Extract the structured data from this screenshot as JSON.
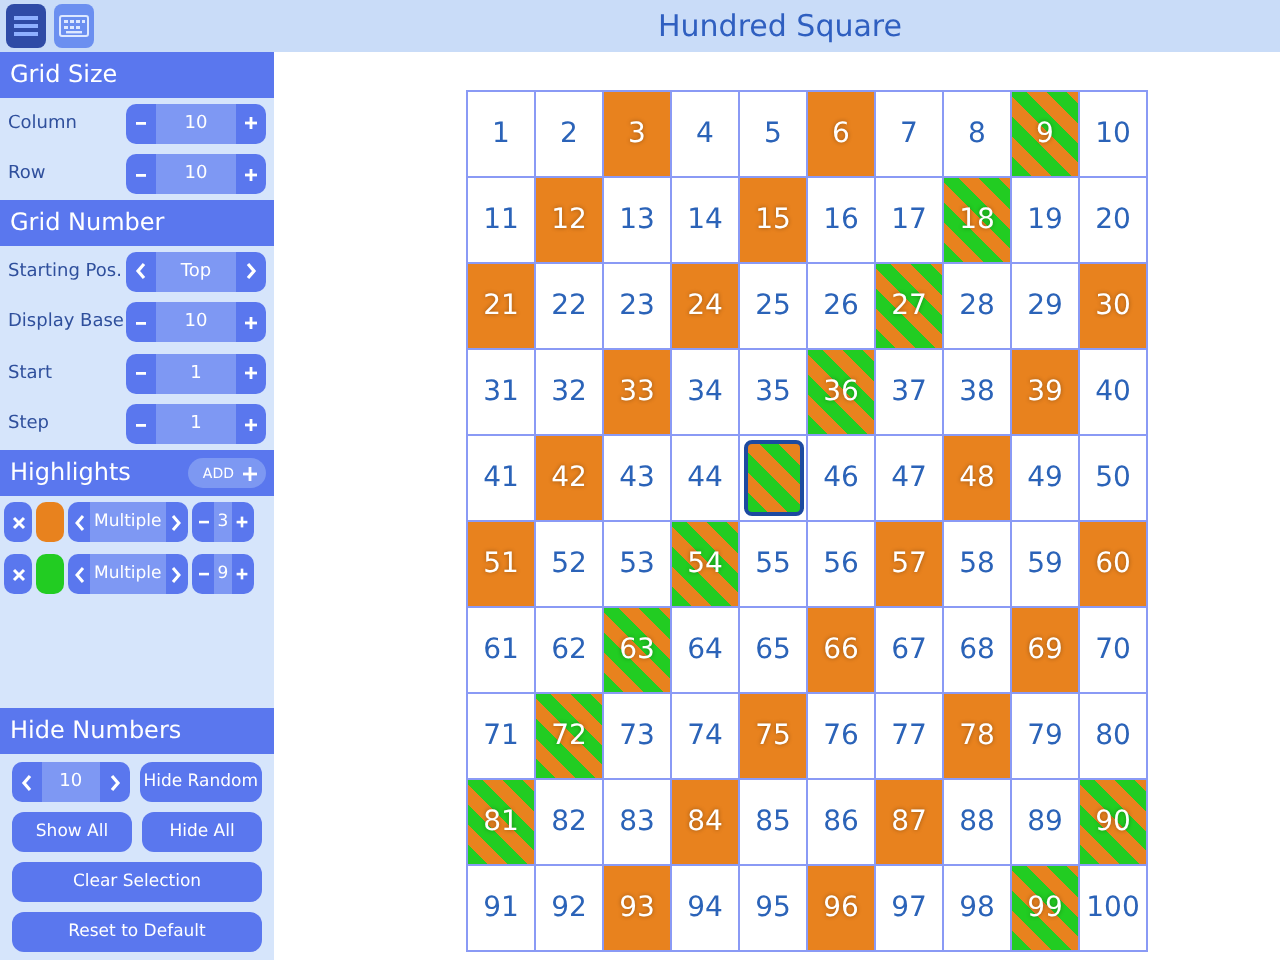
{
  "title": "Hundred Square",
  "grid_size": {
    "title": "Grid Size",
    "rows": [
      {
        "label": "Column",
        "kind": "stepper",
        "value": "10"
      },
      {
        "label": "Row",
        "kind": "stepper",
        "value": "10"
      }
    ]
  },
  "grid_number": {
    "title": "Grid Number",
    "rows": [
      {
        "label": "Starting Pos.",
        "kind": "selector",
        "value": "Top"
      },
      {
        "label": "Display Base",
        "kind": "stepper",
        "value": "10"
      },
      {
        "label": "Start",
        "kind": "stepper",
        "value": "1"
      },
      {
        "label": "Step",
        "kind": "stepper",
        "value": "1"
      }
    ]
  },
  "highlights": {
    "title": "Highlights",
    "add_label": "ADD",
    "items": [
      {
        "color": "#e8821e",
        "rule": "Multiple",
        "value": "3"
      },
      {
        "color": "#22cc22",
        "rule": "Multiple",
        "value": "9"
      }
    ]
  },
  "hide_numbers": {
    "title": "Hide Numbers",
    "count": "10",
    "hide_random": "Hide Random",
    "show_all": "Show All",
    "hide_all": "Hide All",
    "clear": "Clear Selection",
    "reset": "Reset to Default"
  },
  "cells": [
    {
      "text": "1",
      "kind": "plain",
      "hidden": false
    },
    {
      "text": "2",
      "kind": "plain",
      "hidden": false
    },
    {
      "text": "3",
      "kind": "single",
      "hidden": false
    },
    {
      "text": "4",
      "kind": "plain",
      "hidden": false
    },
    {
      "text": "5",
      "kind": "plain",
      "hidden": false
    },
    {
      "text": "6",
      "kind": "single",
      "hidden": false
    },
    {
      "text": "7",
      "kind": "plain",
      "hidden": false
    },
    {
      "text": "8",
      "kind": "plain",
      "hidden": false
    },
    {
      "text": "9",
      "kind": "double",
      "hidden": false
    },
    {
      "text": "10",
      "kind": "plain",
      "hidden": false
    },
    {
      "text": "11",
      "kind": "plain",
      "hidden": false
    },
    {
      "text": "12",
      "kind": "single",
      "hidden": false
    },
    {
      "text": "13",
      "kind": "plain",
      "hidden": false
    },
    {
      "text": "14",
      "kind": "plain",
      "hidden": false
    },
    {
      "text": "15",
      "kind": "single",
      "hidden": false
    },
    {
      "text": "16",
      "kind": "plain",
      "hidden": false
    },
    {
      "text": "17",
      "kind": "plain",
      "hidden": false
    },
    {
      "text": "18",
      "kind": "double",
      "hidden": false
    },
    {
      "text": "19",
      "kind": "plain",
      "hidden": false
    },
    {
      "text": "20",
      "kind": "plain",
      "hidden": false
    },
    {
      "text": "21",
      "kind": "single",
      "hidden": false
    },
    {
      "text": "22",
      "kind": "plain",
      "hidden": false
    },
    {
      "text": "23",
      "kind": "plain",
      "hidden": false
    },
    {
      "text": "24",
      "kind": "single",
      "hidden": false
    },
    {
      "text": "25",
      "kind": "plain",
      "hidden": false
    },
    {
      "text": "26",
      "kind": "plain",
      "hidden": false
    },
    {
      "text": "27",
      "kind": "double",
      "hidden": false
    },
    {
      "text": "28",
      "kind": "plain",
      "hidden": false
    },
    {
      "text": "29",
      "kind": "plain",
      "hidden": false
    },
    {
      "text": "30",
      "kind": "single",
      "hidden": false
    },
    {
      "text": "31",
      "kind": "plain",
      "hidden": false
    },
    {
      "text": "32",
      "kind": "plain",
      "hidden": false
    },
    {
      "text": "33",
      "kind": "single",
      "hidden": false
    },
    {
      "text": "34",
      "kind": "plain",
      "hidden": false
    },
    {
      "text": "35",
      "kind": "plain",
      "hidden": false
    },
    {
      "text": "36",
      "kind": "double",
      "hidden": false
    },
    {
      "text": "37",
      "kind": "plain",
      "hidden": false
    },
    {
      "text": "38",
      "kind": "plain",
      "hidden": false
    },
    {
      "text": "39",
      "kind": "single",
      "hidden": false
    },
    {
      "text": "40",
      "kind": "plain",
      "hidden": false
    },
    {
      "text": "41",
      "kind": "plain",
      "hidden": false
    },
    {
      "text": "42",
      "kind": "single",
      "hidden": false
    },
    {
      "text": "43",
      "kind": "plain",
      "hidden": false
    },
    {
      "text": "44",
      "kind": "plain",
      "hidden": false
    },
    {
      "kind": "double",
      "hidden": true
    },
    {
      "text": "46",
      "kind": "plain",
      "hidden": false
    },
    {
      "text": "47",
      "kind": "plain",
      "hidden": false
    },
    {
      "text": "48",
      "kind": "single",
      "hidden": false
    },
    {
      "text": "49",
      "kind": "plain",
      "hidden": false
    },
    {
      "text": "50",
      "kind": "plain",
      "hidden": false
    },
    {
      "text": "51",
      "kind": "single",
      "hidden": false
    },
    {
      "text": "52",
      "kind": "plain",
      "hidden": false
    },
    {
      "text": "53",
      "kind": "plain",
      "hidden": false
    },
    {
      "text": "54",
      "kind": "double",
      "hidden": false
    },
    {
      "text": "55",
      "kind": "plain",
      "hidden": false
    },
    {
      "text": "56",
      "kind": "plain",
      "hidden": false
    },
    {
      "text": "57",
      "kind": "single",
      "hidden": false
    },
    {
      "text": "58",
      "kind": "plain",
      "hidden": false
    },
    {
      "text": "59",
      "kind": "plain",
      "hidden": false
    },
    {
      "text": "60",
      "kind": "single",
      "hidden": false
    },
    {
      "text": "61",
      "kind": "plain",
      "hidden": false
    },
    {
      "text": "62",
      "kind": "plain",
      "hidden": false
    },
    {
      "text": "63",
      "kind": "double",
      "hidden": false
    },
    {
      "text": "64",
      "kind": "plain",
      "hidden": false
    },
    {
      "text": "65",
      "kind": "plain",
      "hidden": false
    },
    {
      "text": "66",
      "kind": "single",
      "hidden": false
    },
    {
      "text": "67",
      "kind": "plain",
      "hidden": false
    },
    {
      "text": "68",
      "kind": "plain",
      "hidden": false
    },
    {
      "text": "69",
      "kind": "single",
      "hidden": false
    },
    {
      "text": "70",
      "kind": "plain",
      "hidden": false
    },
    {
      "text": "71",
      "kind": "plain",
      "hidden": false
    },
    {
      "text": "72",
      "kind": "double",
      "hidden": false
    },
    {
      "text": "73",
      "kind": "plain",
      "hidden": false
    },
    {
      "text": "74",
      "kind": "plain",
      "hidden": false
    },
    {
      "text": "75",
      "kind": "single",
      "hidden": false
    },
    {
      "text": "76",
      "kind": "plain",
      "hidden": false
    },
    {
      "text": "77",
      "kind": "plain",
      "hidden": false
    },
    {
      "text": "78",
      "kind": "single",
      "hidden": false
    },
    {
      "text": "79",
      "kind": "plain",
      "hidden": false
    },
    {
      "text": "80",
      "kind": "plain",
      "hidden": false
    },
    {
      "text": "81",
      "kind": "double",
      "hidden": false
    },
    {
      "text": "82",
      "kind": "plain",
      "hidden": false
    },
    {
      "text": "83",
      "kind": "plain",
      "hidden": false
    },
    {
      "text": "84",
      "kind": "single",
      "hidden": false
    },
    {
      "text": "85",
      "kind": "plain",
      "hidden": false
    },
    {
      "text": "86",
      "kind": "plain",
      "hidden": false
    },
    {
      "text": "87",
      "kind": "single",
      "hidden": false
    },
    {
      "text": "88",
      "kind": "plain",
      "hidden": false
    },
    {
      "text": "89",
      "kind": "plain",
      "hidden": false
    },
    {
      "text": "90",
      "kind": "double",
      "hidden": false
    },
    {
      "text": "91",
      "kind": "plain",
      "hidden": false
    },
    {
      "text": "92",
      "kind": "plain",
      "hidden": false
    },
    {
      "text": "93",
      "kind": "single",
      "hidden": false
    },
    {
      "text": "94",
      "kind": "plain",
      "hidden": false
    },
    {
      "text": "95",
      "kind": "plain",
      "hidden": false
    },
    {
      "text": "96",
      "kind": "single",
      "hidden": false
    },
    {
      "text": "97",
      "kind": "plain",
      "hidden": false
    },
    {
      "text": "98",
      "kind": "plain",
      "hidden": false
    },
    {
      "text": "99",
      "kind": "double",
      "hidden": false
    },
    {
      "text": "100",
      "kind": "plain",
      "hidden": false
    }
  ]
}
